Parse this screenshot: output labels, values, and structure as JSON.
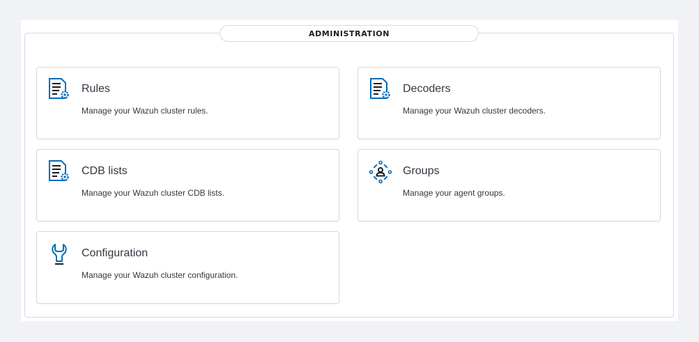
{
  "section_title": "ADMINISTRATION",
  "cards": [
    {
      "title": "Rules",
      "description": "Manage your Wazuh cluster rules.",
      "icon": "rules-document-gear-icon"
    },
    {
      "title": "Decoders",
      "description": "Manage your Wazuh cluster decoders.",
      "icon": "decoders-document-gear-icon"
    },
    {
      "title": "CDB lists",
      "description": "Manage your Wazuh cluster CDB lists.",
      "icon": "cdb-lists-document-gear-icon"
    },
    {
      "title": "Groups",
      "description": "Manage your agent groups.",
      "icon": "agent-groups-icon"
    },
    {
      "title": "Configuration",
      "description": "Manage your Wazuh cluster configuration.",
      "icon": "wrench-icon"
    }
  ],
  "colors": {
    "icon_blue": "#006bb8",
    "icon_dark": "#1a1c21",
    "border": "#d3dae6",
    "background": "#f0f2f5"
  }
}
